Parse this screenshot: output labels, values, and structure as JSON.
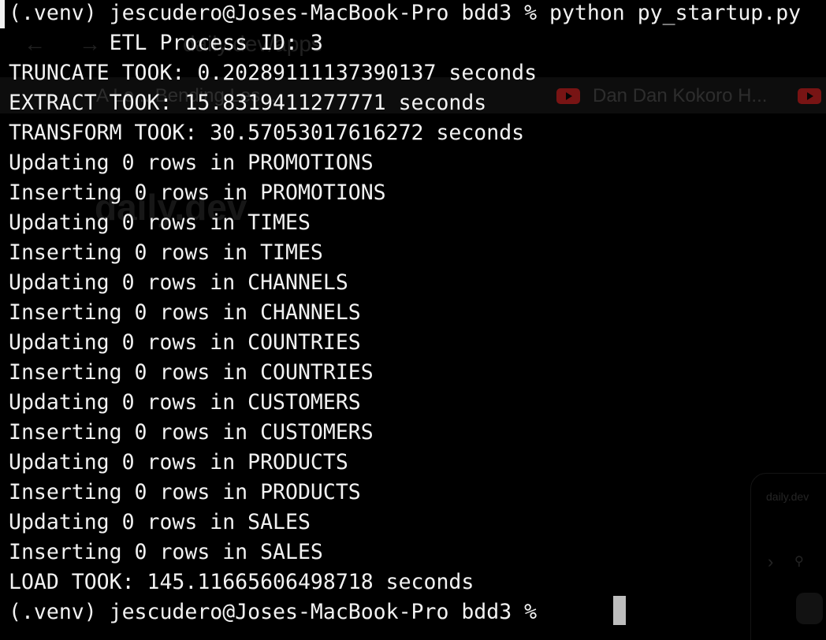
{
  "terminal": {
    "lines": [
      "(.venv) jescudero@Joses-MacBook-Pro bdd3 % python py_startup.py",
      "        ETL Process ID: 3",
      "TRUNCATE TOOK: 0.20289111137390137 seconds",
      "EXTRACT TOOK: 15.8319411277771 seconds",
      "TRANSFORM TOOK: 30.57053017616272 seconds",
      "Updating 0 rows in PROMOTIONS",
      "Inserting 0 rows in PROMOTIONS",
      "Updating 0 rows in TIMES",
      "Inserting 0 rows in TIMES",
      "Updating 0 rows in CHANNELS",
      "Inserting 0 rows in CHANNELS",
      "Updating 0 rows in COUNTRIES",
      "Inserting 0 rows in COUNTRIES",
      "Updating 0 rows in CUSTOMERS",
      "Inserting 0 rows in CUSTOMERS",
      "Updating 0 rows in PRODUCTS",
      "Inserting 0 rows in PRODUCTS",
      "Updating 0 rows in SALES",
      "Inserting 0 rows in SALES",
      "LOAD TOOK: 145.11665606498718 seconds",
      "(.venv) jescudero@Joses-MacBook-Pro bdd3 %"
    ]
  },
  "background_overlay": {
    "url_text": "daily.dev/apps",
    "back_icon": "arrow-left-icon",
    "forward_icon": "arrow-right-icon",
    "bookmark_1": "A  Le... Bending Les...",
    "bookmark_2": "Dan Dan Kokoro H...",
    "logo_text": "daily.dev",
    "card_logo": "daily.dev"
  },
  "colors": {
    "background": "#000000",
    "foreground": "#f2f2f2",
    "cursor": "#bdbdbd"
  }
}
